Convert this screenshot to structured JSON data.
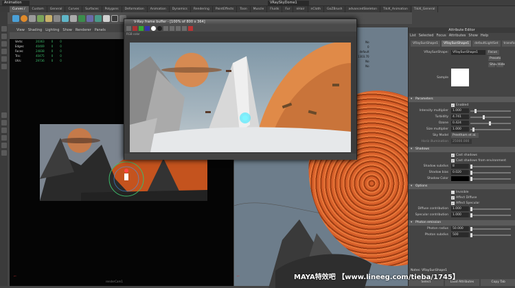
{
  "menubar": {
    "mode": "Animation",
    "object_field": "VRaySkyDome1"
  },
  "shelf_tabs": [
    "Curves / Surfaces",
    "Custom",
    "General",
    "Curves",
    "Surfaces",
    "Polygons",
    "Deformation",
    "Animation",
    "Dynamics",
    "Rendering",
    "PaintEffects",
    "Toon",
    "Muscle",
    "Fluids",
    "Fur",
    "nHair",
    "nCloth",
    "GoZBrush",
    "advancedSkeleton",
    "TikiK_Animation",
    "TikiK_General"
  ],
  "viewport_left": {
    "menu": [
      "View",
      "Shading",
      "Lighting",
      "Show",
      "Renderer",
      "Panels"
    ],
    "hud": [
      {
        "label": "Verts:",
        "v1": "20363",
        "v2": "0",
        "v3": "0"
      },
      {
        "label": "Edges:",
        "v1": "40469",
        "v2": "0",
        "v3": "0"
      },
      {
        "label": "Faces:",
        "v1": "24838",
        "v2": "0",
        "v3": "0"
      },
      {
        "label": "Tris:",
        "v1": "40475",
        "v2": "0",
        "v3": "0"
      },
      {
        "label": "UVs:",
        "v1": "29736",
        "v2": "0",
        "v3": "0"
      }
    ],
    "camera_label": "renderCam1"
  },
  "viewport_right": {
    "hud": [
      "No",
      "0",
      "default",
      "1303.70",
      "No",
      "No"
    ]
  },
  "frame_buffer": {
    "title": "V-Ray frame buffer - [100% of 800 x 364]",
    "channel": "RGB color"
  },
  "attribute_editor": {
    "title": "Attribute Editor",
    "menu": [
      "List",
      "Selected",
      "Focus",
      "Attributes",
      "Show",
      "Help"
    ],
    "tabs": [
      "VRaySunShape1",
      "VRaySunShape1",
      "defaultLightSet",
      "transform1"
    ],
    "node_label": "VRaySunShape:",
    "node_value": "VRaySunShape1",
    "focus_btn": "Focus",
    "presets_btn": "Presets",
    "show_btn": "Show",
    "hide_btn": "Hide",
    "sample_label": "Sample",
    "sections": {
      "parameters": "Parameters",
      "shadows": "Shadows",
      "options": "Options",
      "photon": "Photon emission"
    },
    "enabled": "Enabled",
    "params": [
      {
        "label": "Intensity multiplier",
        "value": "1.000",
        "knob": 0.1
      },
      {
        "label": "Turbidity",
        "value": "4.741",
        "knob": 0.3
      },
      {
        "label": "Ozone",
        "value": "0.424",
        "knob": 0.45
      },
      {
        "label": "Size multiplier",
        "value": "1.000",
        "knob": 0.05
      }
    ],
    "sky_model_label": "Sky Model",
    "sky_model_value": "Preetham et al.",
    "horiz_label": "Horiz illumination",
    "horiz_value": "25000.000",
    "cast_shadows": "Cast shadows",
    "cast_env": "Cast shadows from environment",
    "shadows": [
      {
        "label": "Shadow subdivs",
        "value": "8"
      },
      {
        "label": "Shadow bias",
        "value": "0.020"
      },
      {
        "label": "Shadow Color",
        "value": ""
      }
    ],
    "options_checks": [
      "Invisible",
      "Affect Diffuse",
      "Affect Specular"
    ],
    "options_fields": [
      {
        "label": "Diffuse contribution",
        "value": "1.000"
      },
      {
        "label": "Specular contribution",
        "value": "1.000"
      }
    ],
    "photon": [
      {
        "label": "Photon radius",
        "value": "50.000"
      },
      {
        "label": "Photon subdivs",
        "value": "500"
      }
    ],
    "notes": "Notes: VRaySunShape1",
    "buttons": [
      "Select",
      "Load Attributes",
      "Copy Tab"
    ]
  },
  "watermark": "MAYA特效吧 【www.lineeg.com/tieba/1745】",
  "colors": {
    "planet": "#d8602a",
    "hud_green": "#3dbb6b"
  }
}
